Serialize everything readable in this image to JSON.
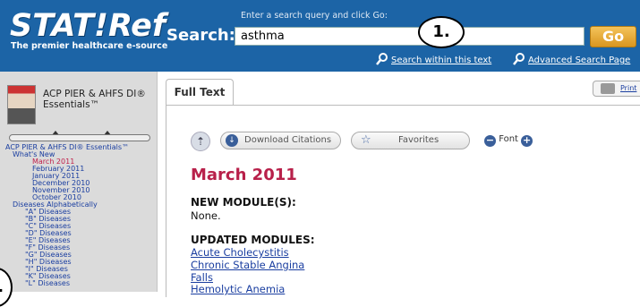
{
  "header": {
    "logo": "STAT!Ref",
    "tagline": "The premier healthcare e-source",
    "search_label": "Search:",
    "search_hint": "Enter a search query and click Go:",
    "search_value": "asthma",
    "go_label": "Go",
    "link_within": "Search within this text",
    "link_advanced": "Advanced Search Page",
    "callout": "1."
  },
  "sidebar": {
    "book_title_1": "ACP PIER & AHFS DI®",
    "book_title_2": "Essentials™",
    "toc": [
      "ACP PIER & AHFS DI® Essentials™",
      "What's New",
      "March 2011",
      "February 2011",
      "January 2011",
      "December 2010",
      "November 2010",
      "October 2010",
      "Diseases Alphabetically",
      "\"A\" Diseases",
      "\"B\" Diseases",
      "\"C\" Diseases",
      "\"D\" Diseases",
      "\"E\" Diseases",
      "\"F\" Diseases",
      "\"G\" Diseases",
      "\"H\" Diseases",
      "\"I\" Diseases",
      "\"K\" Diseases",
      "\"L\" Diseases"
    ],
    "callout": "."
  },
  "main": {
    "tab_label": "Full Text",
    "print_label": "Print",
    "download_label": "Download Citations",
    "favorites_label": "Favorites",
    "font_label": "Font",
    "title": "March 2011",
    "new_heading": "NEW MODULE(S):",
    "new_body": "None.",
    "updated_heading": "UPDATED MODULES:",
    "modules": [
      "Acute Cholecystitis",
      "Chronic Stable Angina",
      "Falls",
      "Hemolytic Anemia"
    ]
  },
  "colors": {
    "header_bg": "#1c64a6",
    "title": "#b8204a",
    "link": "#1a3ea0",
    "go": "#e0a030"
  }
}
